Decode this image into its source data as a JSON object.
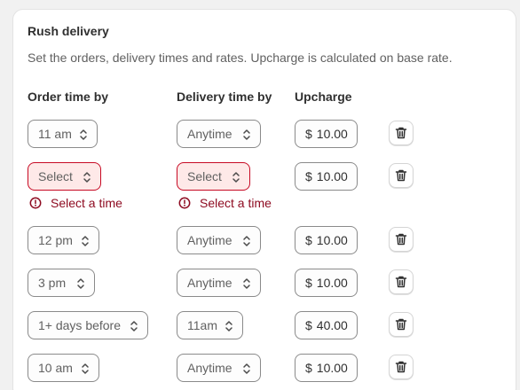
{
  "card": {
    "title": "Rush delivery",
    "description": "Set the orders, delivery times and rates. Upcharge is calculated on base rate."
  },
  "columns": {
    "order_time": "Order time by",
    "delivery_time": "Delivery time by",
    "upcharge": "Upcharge"
  },
  "currency_symbol": "$",
  "error_message": "Select a time",
  "colors": {
    "error_text": "#8e0b21",
    "error_border": "#c70a24",
    "error_bg": "#fee9e8"
  },
  "rows": [
    {
      "order": "11 am",
      "delivery": "Anytime",
      "upcharge": "10.00"
    },
    {
      "order": "Select",
      "delivery": "Select",
      "upcharge": "10.00"
    },
    {
      "order": "12 pm",
      "delivery": "Anytime",
      "upcharge": "10.00"
    },
    {
      "order": "3 pm",
      "delivery": "Anytime",
      "upcharge": "10.00"
    },
    {
      "order": "1+ days before",
      "delivery": "11am",
      "upcharge": "40.00"
    },
    {
      "order": "10 am",
      "delivery": "Anytime",
      "upcharge": "10.00"
    }
  ]
}
